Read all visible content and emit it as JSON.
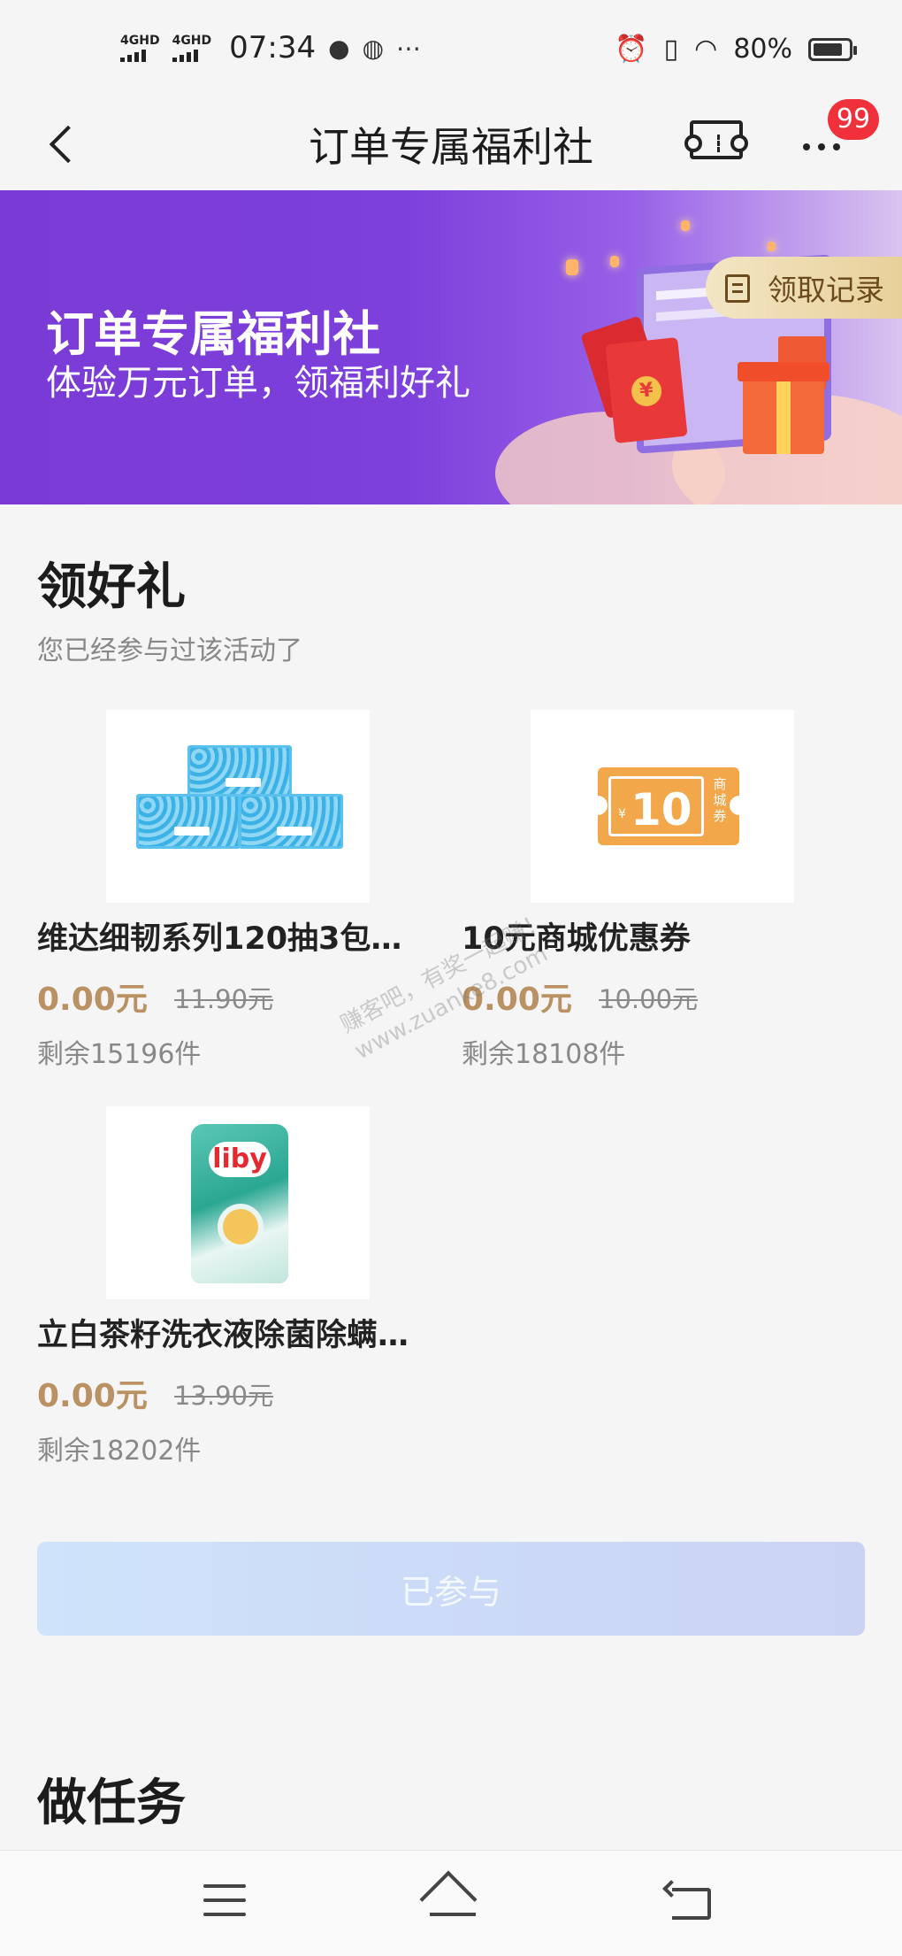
{
  "status_bar": {
    "net1": "4GHD",
    "net2": "4GHD",
    "time": "07:34",
    "battery": "80%"
  },
  "nav": {
    "title": "订单专属福利社",
    "badge": "99"
  },
  "banner": {
    "title": "订单专属福利社",
    "subtitle": "体验万元订单，领福利好礼",
    "record_label": "领取记录"
  },
  "gifts_section": {
    "title": "领好礼",
    "subtitle": "您已经参与过该活动了",
    "products": [
      {
        "name": "维达细韧系列120抽3包…",
        "price": "0.00元",
        "original": "11.90元",
        "stock": "剩余15196件"
      },
      {
        "name": "10元商城优惠券",
        "price": "0.00元",
        "original": "10.00元",
        "stock": "剩余18108件",
        "coupon_value": "10",
        "coupon_text": "商城券",
        "coupon_symbol": "¥"
      },
      {
        "name": "立白茶籽洗衣液除菌除螨…",
        "price": "0.00元",
        "original": "13.90元",
        "stock": "剩余18202件",
        "brand": "liby"
      }
    ],
    "joined_label": "已参与"
  },
  "tasks_section": {
    "title": "做任务"
  },
  "watermark": {
    "line1": "赚客吧，有奖一起赚！",
    "line2": "www.zuanke8.com"
  }
}
